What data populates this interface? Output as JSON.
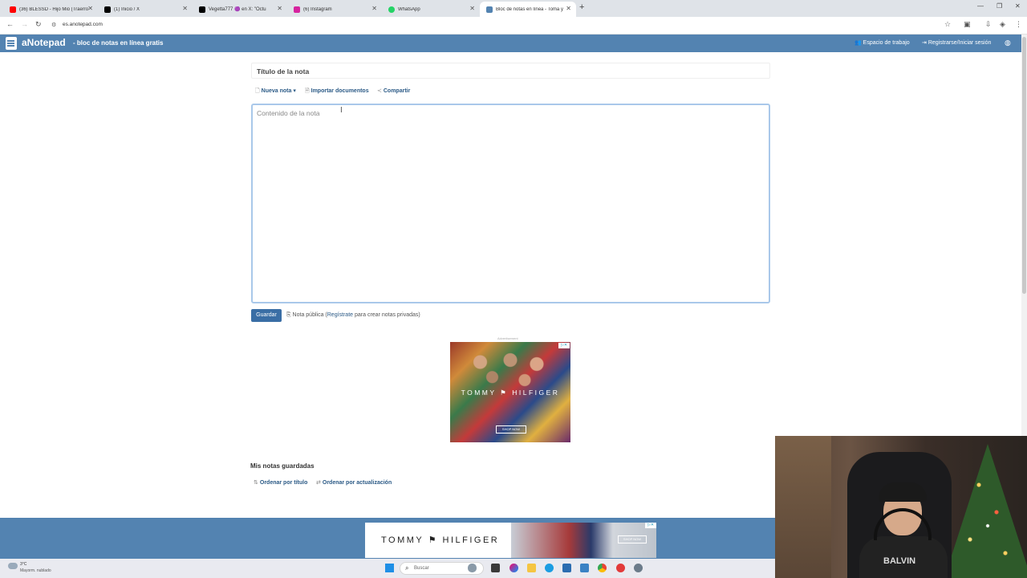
{
  "browser": {
    "tabs": [
      {
        "label": "(36) BLESSD - Hijo Mio (Traerro",
        "favicon_color": "#ff0000",
        "active": false
      },
      {
        "label": "(1) Inicio / X",
        "favicon_color": "#000000",
        "active": false
      },
      {
        "label": "Vegetta777 🟣 en X: \"Octu",
        "favicon_color": "#000000",
        "active": false
      },
      {
        "label": "(6) Instagram",
        "favicon_color": "#d6249f",
        "active": false
      },
      {
        "label": "WhatsApp",
        "favicon_color": "#25d366",
        "active": false
      },
      {
        "label": "Bloc de notas en línea - Toma y",
        "favicon_color": "#5383b1",
        "active": true
      }
    ],
    "new_tab": "+",
    "url": "es.anotepad.com"
  },
  "header": {
    "brand": "aNotepad",
    "tagline": "- bloc de notas en línea gratis",
    "workspace_link": "Espacio de trabajo",
    "login_link": "Registrarse/Iniciar sesión"
  },
  "editor": {
    "title_placeholder": "Título de la nota",
    "new_note": "Nueva nota",
    "import_docs": "Importar documentos",
    "share": "Compartir",
    "content_placeholder": "Contenido de la nota",
    "save": "Guardar",
    "public_note_prefix": "Nota pública (",
    "register_link": "Regístrate",
    "public_note_suffix": " para crear notas privadas)"
  },
  "ads": {
    "label": "Advertisement",
    "brand": "TOMMY ⚑ HILFIGER",
    "banner_brand": "TOMMY ⚑ HILFIGER",
    "cta": "SHOP NOW"
  },
  "saved": {
    "heading": "Mis notas guardadas",
    "sort_title": "Ordenar por título",
    "sort_updated": "Ordenar por actualización"
  },
  "taskbar": {
    "temp": "3°C",
    "weather": "Mayorm. nublado",
    "search_placeholder": "Buscar"
  },
  "webcam": {
    "shirt_text": "BALVIN"
  }
}
